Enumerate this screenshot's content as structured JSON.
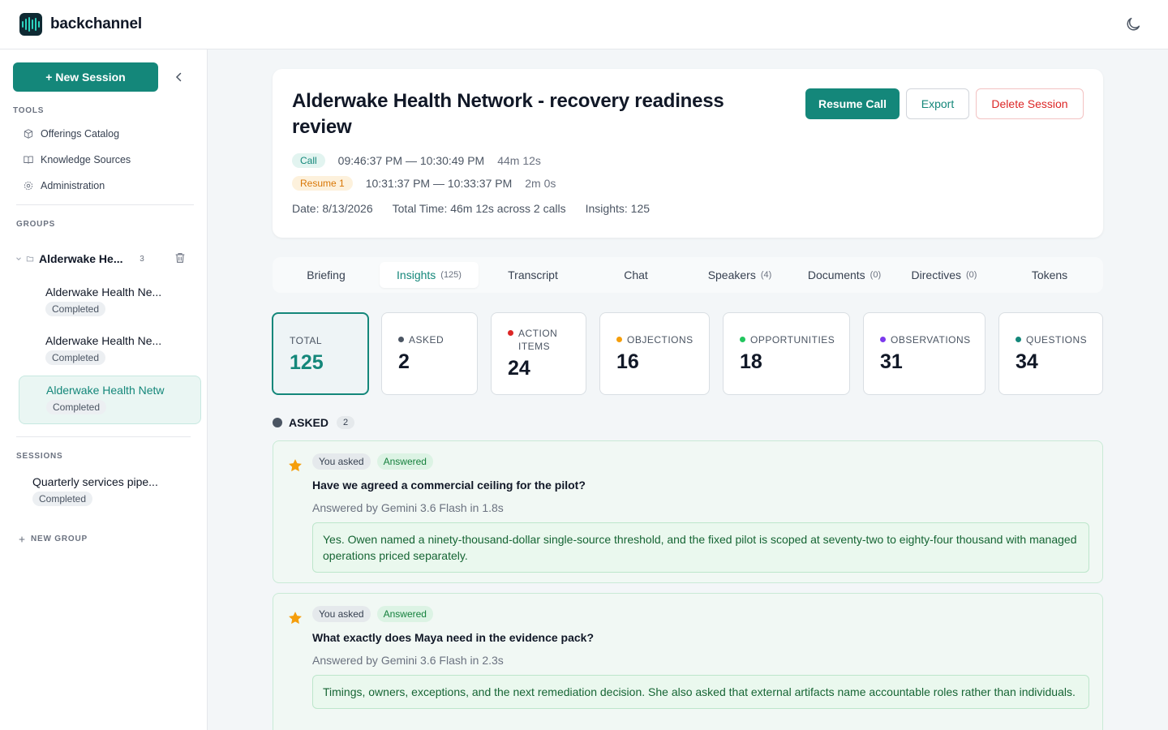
{
  "app": {
    "brand": "backchannel"
  },
  "sidebar": {
    "new_session_label": "+ New Session",
    "tools_label": "TOOLS",
    "tools": [
      {
        "label": "Offerings Catalog",
        "icon": "box-icon"
      },
      {
        "label": "Knowledge Sources",
        "icon": "book-icon"
      },
      {
        "label": "Administration",
        "icon": "gear-icon"
      }
    ],
    "groups_label": "GROUPS",
    "group": {
      "name": "Alderwake He...",
      "count": "3",
      "sessions": [
        {
          "title": "Alderwake Health Ne...",
          "status": "Completed"
        },
        {
          "title": "Alderwake Health Ne...",
          "status": "Completed"
        },
        {
          "title": "Alderwake Health Netw",
          "status": "Completed"
        }
      ]
    },
    "sessions_label": "SESSIONS",
    "sessions": [
      {
        "title": "Quarterly services pipe...",
        "status": "Completed"
      }
    ],
    "new_group_label": "NEW GROUP"
  },
  "header": {
    "title": "Alderwake Health Network - recovery readiness review",
    "buttons": {
      "resume": "Resume Call",
      "export": "Export",
      "delete": "Delete Session"
    },
    "calls": [
      {
        "tag": "Call",
        "range": "09:46:37 PM — 10:30:49 PM",
        "duration": "44m 12s"
      },
      {
        "tag": "Resume 1",
        "range": "10:31:37 PM — 10:33:37 PM",
        "duration": "2m 0s"
      }
    ],
    "date": "Date: 8/13/2026",
    "total_time": "Total Time: 46m 12s across 2 calls",
    "insights": "Insights: 125"
  },
  "tabs": [
    {
      "label": "Briefing",
      "count": ""
    },
    {
      "label": "Insights",
      "count": "(125)"
    },
    {
      "label": "Transcript",
      "count": ""
    },
    {
      "label": "Chat",
      "count": ""
    },
    {
      "label": "Speakers",
      "count": "(4)"
    },
    {
      "label": "Documents",
      "count": "(0)"
    },
    {
      "label": "Directives",
      "count": "(0)"
    },
    {
      "label": "Tokens",
      "count": ""
    }
  ],
  "stats": [
    {
      "label": "TOTAL",
      "value": "125",
      "color": ""
    },
    {
      "label": "ASKED",
      "value": "2",
      "color": "#4b5563"
    },
    {
      "label": "ACTION ITEMS",
      "value": "24",
      "color": "#dc2626"
    },
    {
      "label": "OBJECTIONS",
      "value": "16",
      "color": "#f59e0b"
    },
    {
      "label": "OPPORTUNITIES",
      "value": "18",
      "color": "#22c55e"
    },
    {
      "label": "OBSERVATIONS",
      "value": "31",
      "color": "#7c3aed"
    },
    {
      "label": "QUESTIONS",
      "value": "34",
      "color": "#14877a"
    }
  ],
  "asked_section": {
    "label": "ASKED",
    "count": "2",
    "items": [
      {
        "asked_tag": "You asked",
        "status_tag": "Answered",
        "question": "Have we agreed a commercial ceiling for the pilot?",
        "meta": "Answered by Gemini 3.6 Flash in 1.8s",
        "answer": "Yes. Owen named a ninety-thousand-dollar single-source threshold, and the fixed pilot is scoped at seventy-two to eighty-four thousand with managed operations priced separately."
      },
      {
        "asked_tag": "You asked",
        "status_tag": "Answered",
        "question": "What exactly does Maya need in the evidence pack?",
        "meta": "Answered by Gemini 3.6 Flash in 2.3s",
        "answer": "Timings, owners, exceptions, and the next remediation decision. She also asked that external artifacts name accountable roles rather than individuals."
      }
    ]
  },
  "colors": {
    "accent": "#14877a",
    "danger": "#dc2626",
    "star": "#f59e0b"
  }
}
